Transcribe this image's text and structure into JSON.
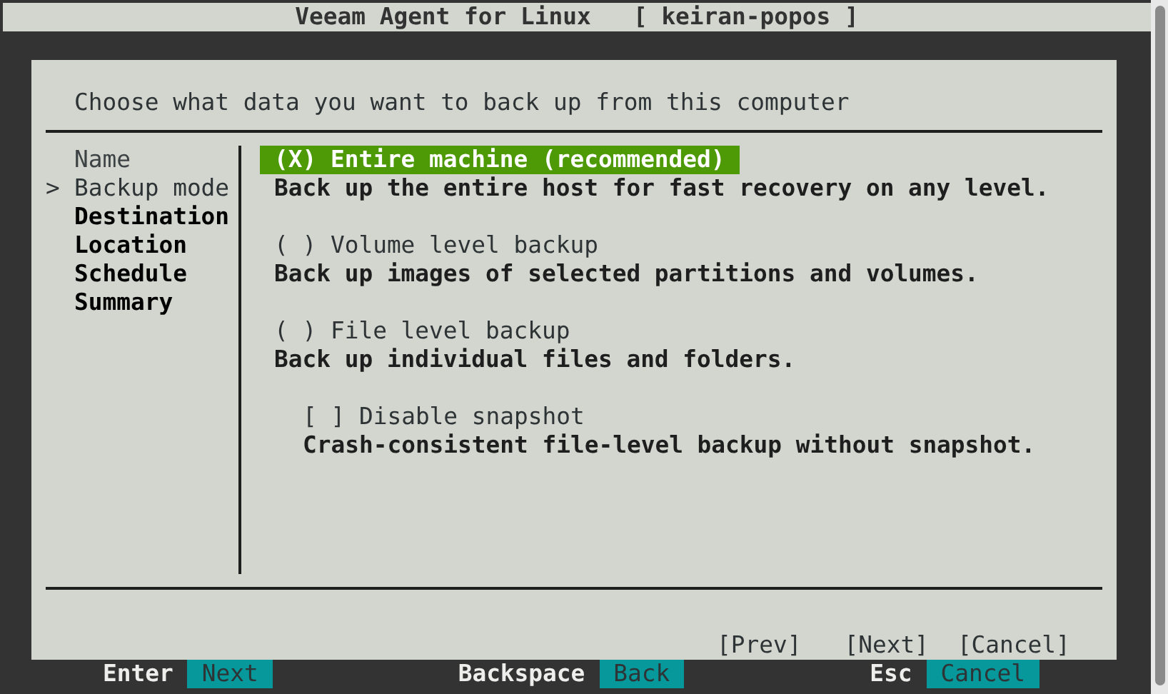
{
  "window": {
    "title": "Veeam Agent for Linux   [ keiran-popos ]"
  },
  "heading": "Choose what data you want to back up from this computer",
  "steps": {
    "marker": ">",
    "items": [
      {
        "label": "Name",
        "selected": false,
        "completed": true
      },
      {
        "label": "Backup mode",
        "selected": true,
        "completed": false
      },
      {
        "label": "Destination",
        "selected": false,
        "completed": false
      },
      {
        "label": "Location",
        "selected": false,
        "completed": false
      },
      {
        "label": "Schedule",
        "selected": false,
        "completed": false
      },
      {
        "label": "Summary",
        "selected": false,
        "completed": false
      }
    ]
  },
  "options": [
    {
      "kind": "radio",
      "box": "(X)",
      "label": "Entire machine (recommended)",
      "focused": true,
      "description": "Back up the entire host for fast recovery on any level."
    },
    {
      "kind": "radio",
      "box": "( )",
      "label": "Volume level backup",
      "focused": false,
      "description": "Back up images of selected partitions and volumes."
    },
    {
      "kind": "radio",
      "box": "( )",
      "label": "File level backup",
      "focused": false,
      "description": "Back up individual files and folders."
    },
    {
      "kind": "checkbox",
      "box": "[ ]",
      "label": "Disable snapshot",
      "focused": false,
      "description": "Crash-consistent file-level backup without snapshot."
    }
  ],
  "buttons": [
    "[Prev]",
    "[Next]",
    "[Cancel]"
  ],
  "shortcuts": [
    {
      "key": "Enter",
      "action": "Next"
    },
    {
      "key": "Backspace",
      "action": "Back"
    },
    {
      "key": "Esc",
      "action": "Cancel"
    }
  ]
}
